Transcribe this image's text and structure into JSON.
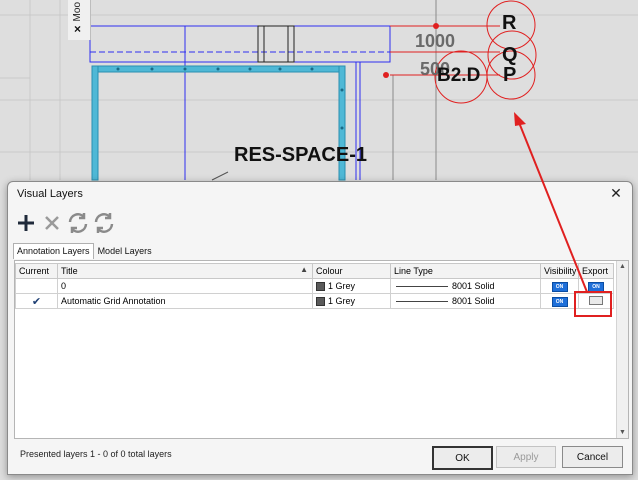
{
  "side_panel": {
    "vertical_label": "Moo",
    "close_glyph": "×"
  },
  "cad": {
    "space_label": "RES-SPACE-1",
    "dim_1000": "1000",
    "dim_500": "500",
    "grid_b2d": "B2.D",
    "bubble_R": "R",
    "bubble_Q": "Q",
    "bubble_P": "P"
  },
  "dialog": {
    "title": "Visual Layers",
    "close_glyph": "✕",
    "toolbar": [
      {
        "name": "add-layer-button",
        "icon": "plus-icon"
      },
      {
        "name": "delete-layer-button",
        "icon": "x-icon"
      },
      {
        "name": "refresh-button",
        "icon": "refresh-icon"
      },
      {
        "name": "refresh-all-button",
        "icon": "refresh-icon"
      }
    ],
    "tabs": [
      "Annotation Layers",
      "Model Layers"
    ],
    "columns": [
      "Current",
      "Title",
      "Colour",
      "Line Type",
      "Visibility",
      "Export"
    ],
    "rows": [
      {
        "current": "",
        "title": "0",
        "colour": "1 Grey",
        "line_type": "8001 Solid",
        "visibility": "ON",
        "export": "ON"
      },
      {
        "current": "✔",
        "title": "Automatic Grid Annotation",
        "colour": "1 Grey",
        "line_type": "8001 Solid",
        "visibility": "ON",
        "export": ""
      }
    ],
    "status": "Presented layers 1 - 0 of 0 total layers",
    "buttons": {
      "ok": "OK",
      "apply": "Apply",
      "cancel": "Cancel"
    }
  },
  "colors": {
    "annotation_red": "#e02020",
    "grid_blue": "#2d2df0",
    "cyan_wall": "#4fb8d6",
    "on_blue": "#1e6fd9"
  }
}
